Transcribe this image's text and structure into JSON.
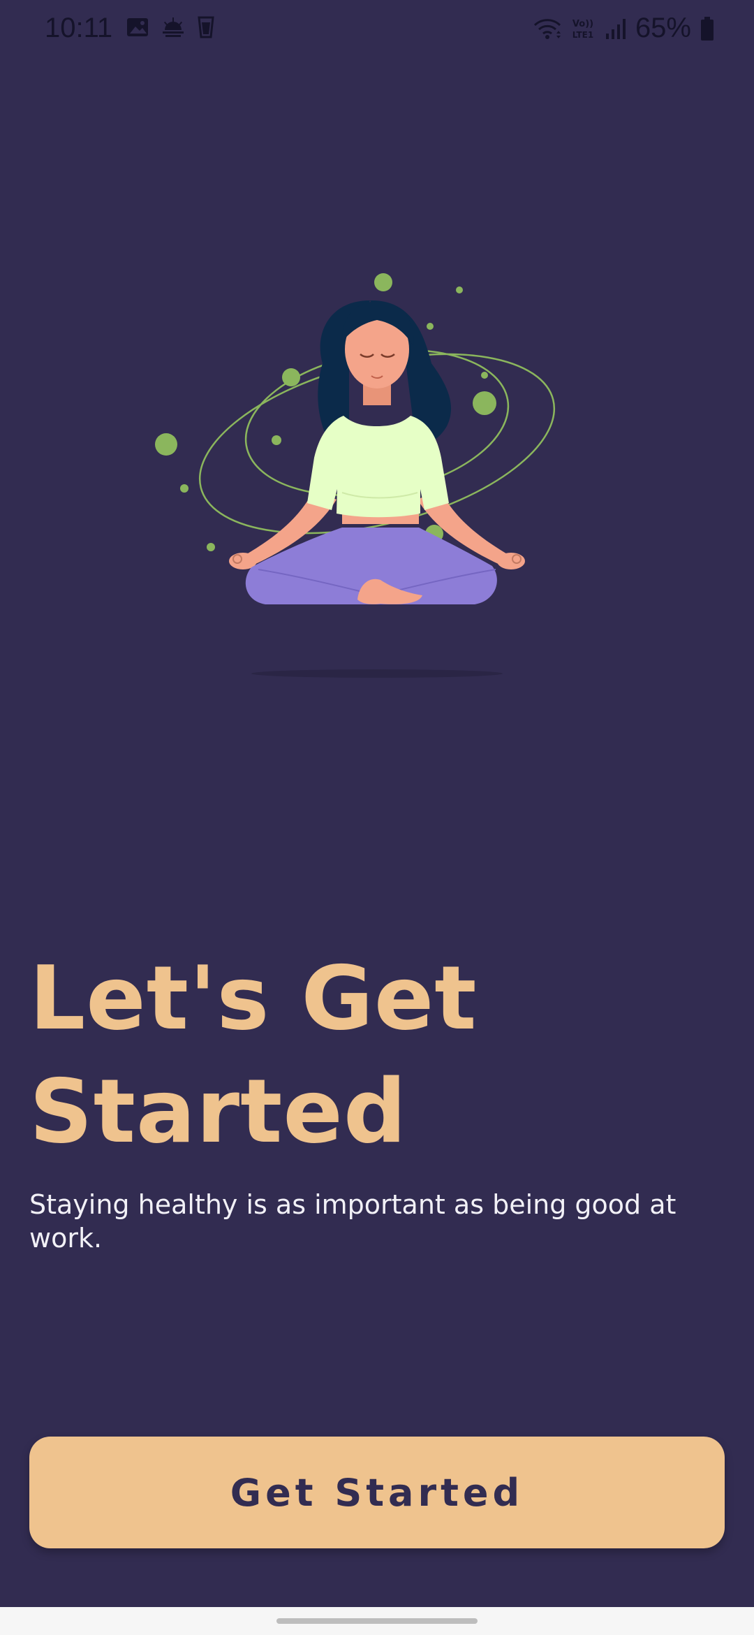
{
  "status_bar": {
    "time": "10:11",
    "battery": "65%",
    "icons_left": [
      "image-icon",
      "weather-icon",
      "cup-icon"
    ],
    "icons_right": [
      "wifi-icon",
      "volte-icon",
      "signal-icon",
      "battery-icon"
    ]
  },
  "onboarding": {
    "title_line1": "Let's Get",
    "title_line2": "Started",
    "subtitle": "Staying healthy is as important as being good at work.",
    "button_label": "Get Started",
    "illustration": "meditation-illustration"
  },
  "colors": {
    "background": "#322C51",
    "accent": "#EFC38E",
    "text_light": "#F2F1F7",
    "status_icons": "#15132a",
    "leaf_green": "#8BB65D",
    "shirt": "#E6FFC6",
    "pants": "#8D7DD7",
    "skin": "#F4A48A",
    "hair": "#0B2A4A"
  }
}
